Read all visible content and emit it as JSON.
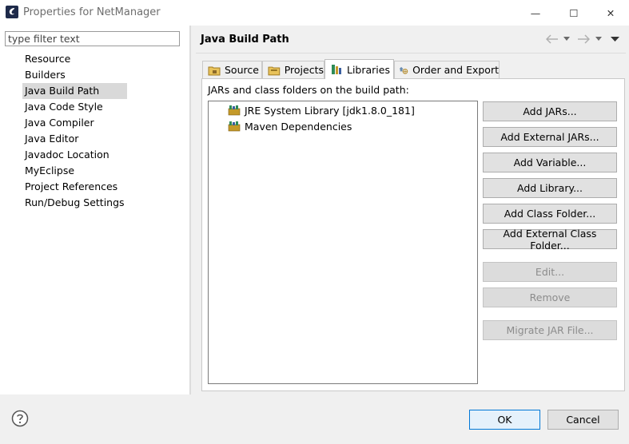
{
  "window": {
    "title": "Properties for NetManager",
    "minimize_glyph": "—",
    "maximize_glyph": "☐",
    "close_glyph": "✕"
  },
  "filter": {
    "placeholder": "type filter text"
  },
  "nav": {
    "items": [
      "Resource",
      "Builders",
      "Java Build Path",
      "Java Code Style",
      "Java Compiler",
      "Java Editor",
      "Javadoc Location",
      "MyEclipse",
      "Project References",
      "Run/Debug Settings"
    ],
    "selected": "Java Build Path"
  },
  "page": {
    "title": "Java Build Path"
  },
  "tabs": [
    "Source",
    "Projects",
    "Libraries",
    "Order and Export"
  ],
  "active_tab": "Libraries",
  "libraries": {
    "label": "JARs and class folders on the build path:",
    "entries": [
      "JRE System Library [jdk1.8.0_181]",
      "Maven Dependencies"
    ]
  },
  "buttons": {
    "add_jars": "Add JARs...",
    "add_external_jars": "Add External JARs...",
    "add_variable": "Add Variable...",
    "add_library": "Add Library...",
    "add_class_folder": "Add Class Folder...",
    "add_external_class_folder": "Add External Class Folder...",
    "edit": "Edit...",
    "remove": "Remove",
    "migrate_jar": "Migrate JAR File..."
  },
  "footer": {
    "ok": "OK",
    "cancel": "Cancel"
  },
  "colors": {
    "accent": "#0078d7",
    "selection": "#d9d9d9",
    "library_icon_green": "#2e8b57"
  }
}
